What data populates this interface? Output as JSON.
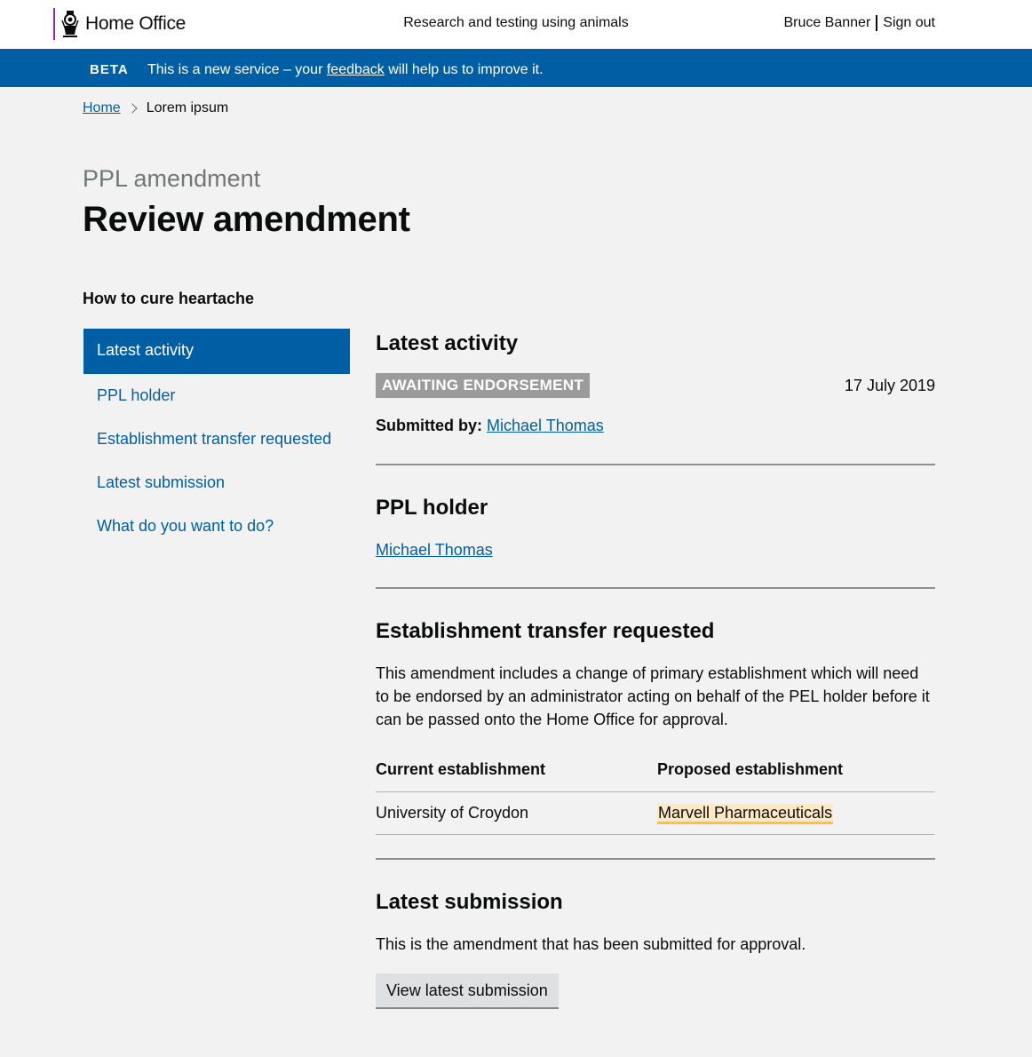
{
  "header": {
    "logo_text": "Home Office",
    "service_name": "Research and testing using animals",
    "user_name": "Bruce Banner",
    "sign_out": "Sign out"
  },
  "beta_banner": {
    "tag": "BETA",
    "message_before": "This is a new service – your ",
    "link_text": "feedback",
    "message_after": " will help us to improve it."
  },
  "breadcrumb": {
    "home": "Home",
    "current": "Lorem ipsum"
  },
  "page": {
    "caption": "PPL amendment",
    "title": "Review amendment",
    "project_title": "How to cure heartache"
  },
  "sidenav": {
    "items": [
      {
        "label": "Latest activity",
        "active": true
      },
      {
        "label": "PPL holder",
        "active": false
      },
      {
        "label": "Establishment transfer requested",
        "active": false
      },
      {
        "label": "Latest submission",
        "active": false
      },
      {
        "label": "What do you want to do?",
        "active": false
      }
    ]
  },
  "latest_activity": {
    "heading": "Latest activity",
    "status": "AWAITING ENDORSEMENT",
    "date": "17 July 2019",
    "submitted_by_label": "Submitted by:",
    "submitted_by_name": "Michael Thomas"
  },
  "ppl_holder": {
    "heading": "PPL holder",
    "name": "Michael Thomas"
  },
  "establishment_transfer": {
    "heading": "Establishment transfer requested",
    "description": "This amendment includes a change of primary establishment which will need to be endorsed by an administrator acting on behalf of the PEL holder before it can be passed onto the Home Office for approval.",
    "columns": [
      "Current establishment",
      "Proposed establishment"
    ],
    "current": "University of Croydon",
    "proposed": "Marvell Pharmaceuticals"
  },
  "latest_submission": {
    "heading": "Latest submission",
    "description": "This is the amendment that has been submitted for approval.",
    "button": "View latest submission"
  },
  "colors": {
    "primary_blue": "#005ea5",
    "crest_border": "#9325b2",
    "status_grey": "#9b9b9b",
    "highlight": "#ffe9c4"
  }
}
